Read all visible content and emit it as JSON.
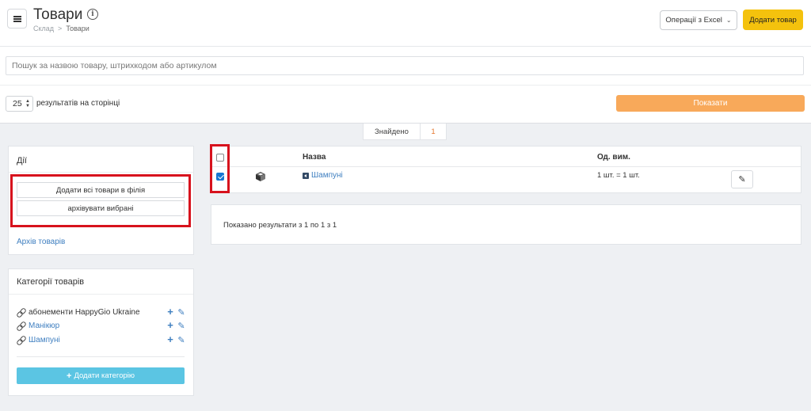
{
  "header": {
    "title": "Товари",
    "breadcrumb": [
      "Склад",
      "Товари"
    ],
    "excel_button": "Операції з Excel",
    "add_product_button": "Додати товар"
  },
  "search": {
    "placeholder": "Пошук за назвою товару, штрихкодом або артикулом",
    "value": ""
  },
  "pagination": {
    "per_page": "25",
    "per_page_label": "результатів на сторінці",
    "show_button": "Показати"
  },
  "found": {
    "label": "Знайдено",
    "count": "1"
  },
  "actions": {
    "title": "Дії",
    "add_all_button": "Додати всі товари в філія",
    "archive_button": "архівувати вибрані",
    "archive_link": "Архів товарів"
  },
  "categories": {
    "title": "Категорії товарів",
    "items": [
      {
        "name": "абонементи HappyGio Ukraine",
        "is_link": false
      },
      {
        "name": "Манікюр",
        "is_link": true
      },
      {
        "name": "Шампуні",
        "is_link": true
      }
    ],
    "add_button": "Додати категорію"
  },
  "table": {
    "columns": {
      "name": "Назва",
      "unit": "Од. вим."
    },
    "rows": [
      {
        "name": "Шампуні",
        "unit": "1 шт. = 1 шт.",
        "checked": true
      }
    ]
  },
  "results": {
    "text": "Показано результати з 1 по 1 з 1"
  },
  "colors": {
    "accent_yellow": "#f4c20d",
    "show_orange": "#f8a95a",
    "link_blue": "#3f7fc0",
    "category_button": "#5bc5e3",
    "highlight_red": "#d7121d"
  }
}
